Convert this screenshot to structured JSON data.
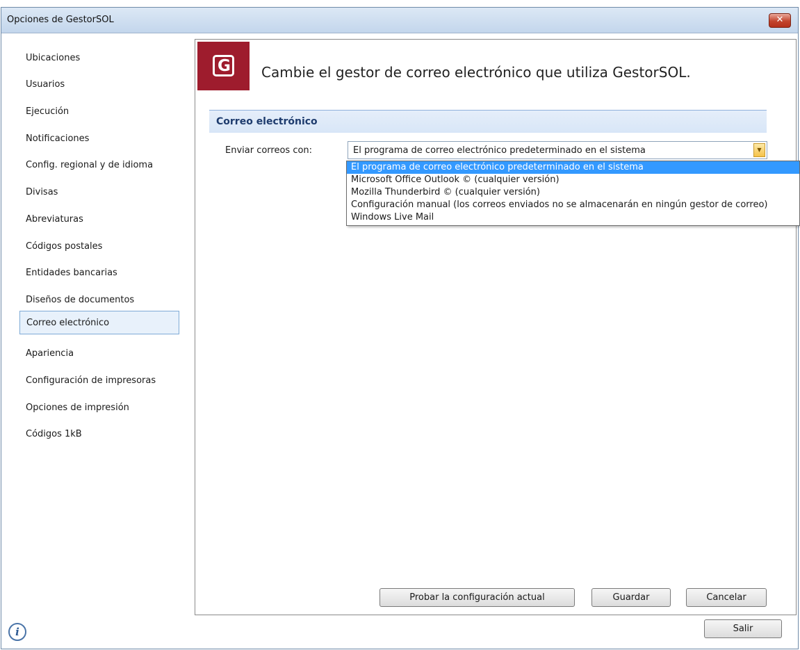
{
  "window": {
    "title": "Opciones de GestorSOL",
    "close_glyph": "✕"
  },
  "nav": {
    "items": [
      {
        "label": "Ubicaciones",
        "selected": false
      },
      {
        "label": "Usuarios",
        "selected": false
      },
      {
        "label": "Ejecución",
        "selected": false
      },
      {
        "label": "Notificaciones",
        "selected": false
      },
      {
        "label": "Config. regional y de idioma",
        "selected": false
      },
      {
        "label": "Divisas",
        "selected": false
      },
      {
        "label": "Abreviaturas",
        "selected": false
      },
      {
        "label": "Códigos postales",
        "selected": false
      },
      {
        "label": "Entidades bancarias",
        "selected": false
      },
      {
        "label": "Diseños de documentos",
        "selected": false
      },
      {
        "label": "Correo electrónico",
        "selected": true
      },
      {
        "label": "Apariencia",
        "selected": false
      },
      {
        "label": "Configuración de impresoras",
        "selected": false
      },
      {
        "label": "Opciones de impresión",
        "selected": false
      },
      {
        "label": "Códigos 1kB",
        "selected": false
      }
    ]
  },
  "main": {
    "logo_letter": "G",
    "header": "Cambie el gestor de correo electrónico que utiliza GestorSOL.",
    "section_title": "Correo electrónico",
    "field_label": "Enviar correos con:",
    "combo_value": "El programa de correo electrónico predeterminado en el sistema",
    "combo_arrow": "▼",
    "options": [
      "El programa de correo electrónico predeterminado en el sistema",
      "Microsoft Office Outlook © (cualquier versión)",
      "Mozilla Thunderbird © (cualquier versión)",
      "Configuración manual (los correos enviados no se almacenarán en ningún gestor de correo)",
      "Windows Live Mail"
    ],
    "selected_option_index": 0,
    "buttons": {
      "test": "Probar la configuración actual",
      "save": "Guardar",
      "cancel": "Cancelar"
    }
  },
  "footer": {
    "info_glyph": "i",
    "exit_label": "Salir"
  },
  "colors": {
    "logo": "#9e1c2d",
    "selection": "#3399ff",
    "nav_selected_border": "#7eaad6"
  }
}
